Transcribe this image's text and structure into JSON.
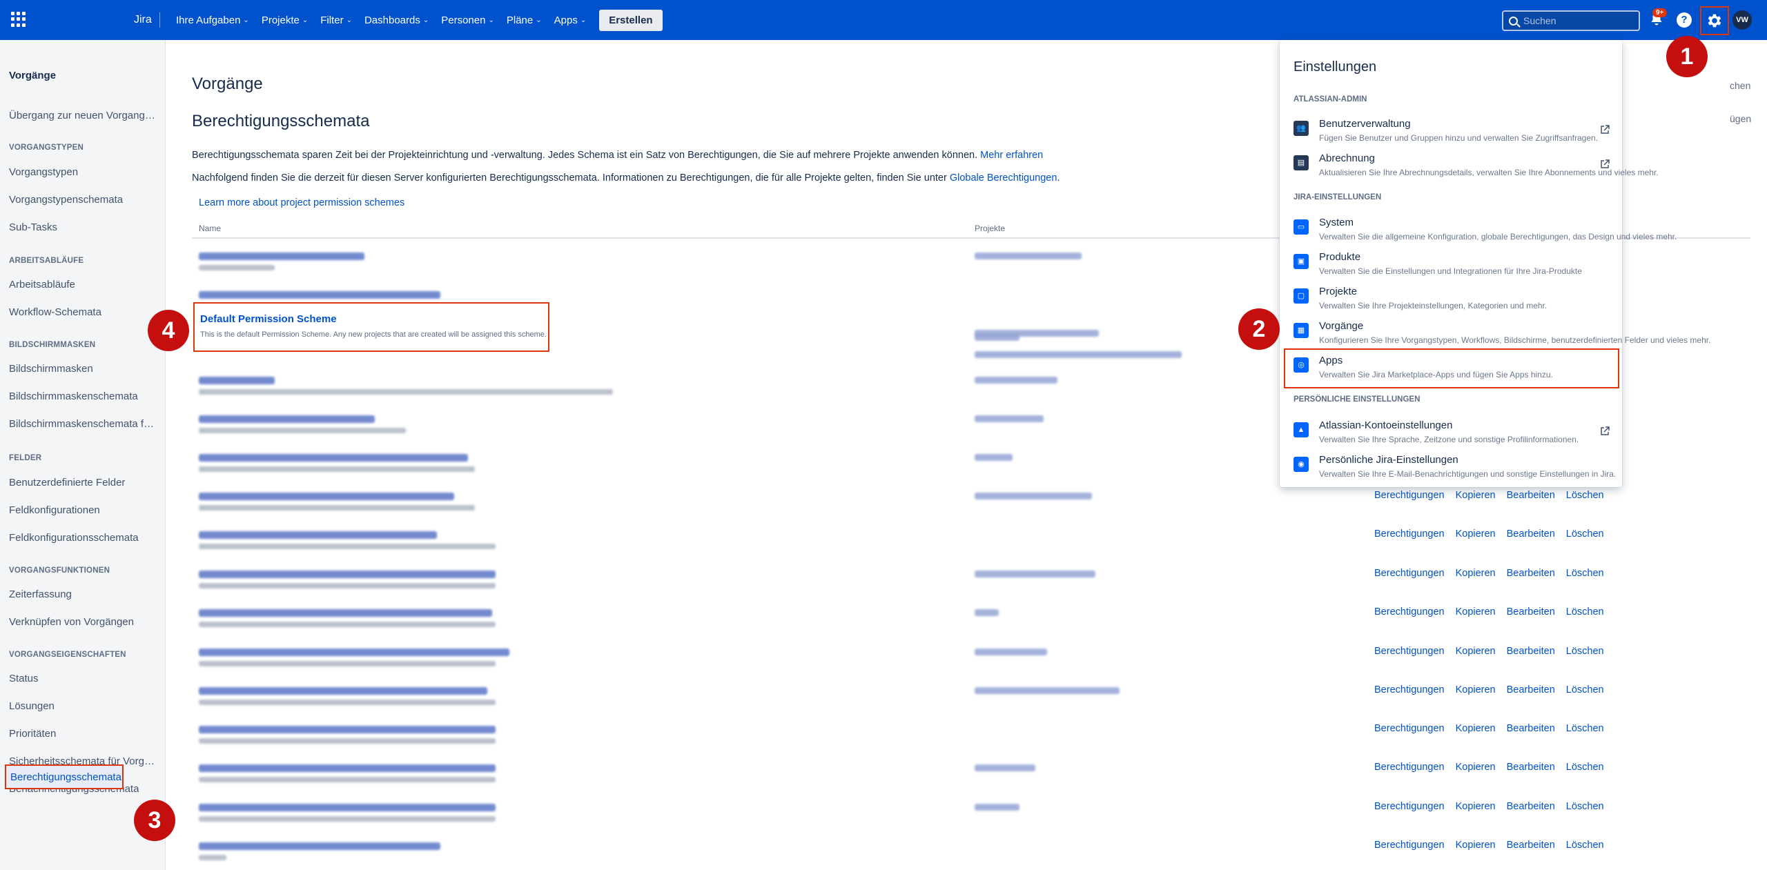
{
  "topbar": {
    "logo": "Jira",
    "nav": [
      "Ihre Aufgaben",
      "Projekte",
      "Filter",
      "Dashboards",
      "Personen",
      "Pläne",
      "Apps"
    ],
    "create_label": "Erstellen",
    "search_placeholder": "Suchen",
    "notifications_badge": "9+",
    "help_label": "?",
    "avatar_initials": "VW"
  },
  "sidebar": {
    "title": "Vorgänge",
    "items": [
      {
        "type": "item",
        "label": "Übergang zur neuen Vorgangs..."
      },
      {
        "type": "head",
        "label": "VORGANGSTYPEN"
      },
      {
        "type": "item",
        "label": "Vorgangstypen"
      },
      {
        "type": "item",
        "label": "Vorgangstypenschemata"
      },
      {
        "type": "item",
        "label": "Sub-Tasks"
      },
      {
        "type": "head",
        "label": "ARBEITSABLÄUFE"
      },
      {
        "type": "item",
        "label": "Arbeitsabläufe"
      },
      {
        "type": "item",
        "label": "Workflow-Schemata"
      },
      {
        "type": "head",
        "label": "BILDSCHIRMMASKEN"
      },
      {
        "type": "item",
        "label": "Bildschirmmasken"
      },
      {
        "type": "item",
        "label": "Bildschirmmaskenschemata"
      },
      {
        "type": "item",
        "label": "Bildschirmmaskenschemata für..."
      },
      {
        "type": "head",
        "label": "FELDER"
      },
      {
        "type": "item",
        "label": "Benutzerdefinierte Felder"
      },
      {
        "type": "item",
        "label": "Feldkonfigurationen"
      },
      {
        "type": "item",
        "label": "Feldkonfigurationsschemata"
      },
      {
        "type": "head",
        "label": "VORGANGSFUNKTIONEN"
      },
      {
        "type": "item",
        "label": "Zeiterfassung"
      },
      {
        "type": "item",
        "label": "Verknüpfen von Vorgängen"
      },
      {
        "type": "head",
        "label": "VORGANGSEIGENSCHAFTEN"
      },
      {
        "type": "item",
        "label": "Status"
      },
      {
        "type": "item",
        "label": "Lösungen"
      },
      {
        "type": "item",
        "label": "Prioritäten"
      },
      {
        "type": "item",
        "label": "Sicherheitsschemata für Vorgä..."
      },
      {
        "type": "item",
        "label": "Benachrichtigungsschemata"
      }
    ],
    "active": "Berechtigungsschemata"
  },
  "main": {
    "title": "Vorgänge",
    "subtitle": "Berechtigungsschemata",
    "desc1": "Berechtigungsschemata sparen Zeit bei der Projekteinrichtung und -verwaltung. Jedes Schema ist ein Satz von Berechtigungen, die Sie auf mehrere Projekte anwenden können.",
    "desc1_link": "Mehr erfahren",
    "desc2": "Nachfolgend finden Sie die derzeit für diesen Server konfigurierten Berechtigungsschemata. Informationen zu Berechtigungen, die für alle Projekte gelten, finden Sie unter",
    "desc2_link": "Globale Berechtigungen",
    "desc2_end": ".",
    "learn_more": "Learn more about project permission schemes",
    "col_name": "Name",
    "col_projects": "Projekte",
    "edge_top": "chen",
    "edge_btn": "ügen",
    "default_scheme": {
      "name": "Default Permission Scheme",
      "desc": "This is the default Permission Scheme. Any new projects that are created will be assigned this scheme."
    },
    "ops": {
      "permissions": "Berechtigungen",
      "copy": "Kopieren",
      "edit": "Bearbeiten",
      "delete": "Löschen"
    }
  },
  "markers": [
    "1",
    "2",
    "3",
    "4"
  ],
  "dropdown": {
    "title": "Einstellungen",
    "sections": [
      {
        "head": "ATLASSIAN-ADMIN",
        "items": [
          {
            "label": "Benutzerverwaltung",
            "sub": "Fügen Sie Benutzer und Gruppen hinzu und verwalten Sie Zugriffsanfragen.",
            "icon": "users-icon",
            "external": true
          },
          {
            "label": "Abrechnung",
            "sub": "Aktualisieren Sie Ihre Abrechnungsdetails, verwalten Sie Ihre Abonnements und vieles mehr.",
            "icon": "billing-icon",
            "external": true
          }
        ]
      },
      {
        "head": "JIRA-EINSTELLUNGEN",
        "items": [
          {
            "label": "System",
            "sub": "Verwalten Sie die allgemeine Konfiguration, globale Berechtigungen, das Design und vieles mehr.",
            "icon": "monitor-icon",
            "external": false
          },
          {
            "label": "Produkte",
            "sub": "Verwalten Sie die Einstellungen und Integrationen für Ihre Jira-Produkte",
            "icon": "products-icon",
            "external": false
          },
          {
            "label": "Projekte",
            "sub": "Verwalten Sie Ihre Projekteinstellungen, Kategorien und mehr.",
            "icon": "folder-icon",
            "external": false
          },
          {
            "label": "Vorgänge",
            "sub": "Konfigurieren Sie Ihre Vorgangstypen, Workflows, Bildschirme, benutzerdefinierten Felder und vieles mehr.",
            "icon": "issues-icon",
            "external": false
          },
          {
            "label": "Apps",
            "sub": "Verwalten Sie Jira Marketplace-Apps und fügen Sie Apps hinzu.",
            "icon": "apps-icon",
            "external": false
          }
        ]
      },
      {
        "head": "PERSÖNLICHE EINSTELLUNGEN",
        "items": [
          {
            "label": "Atlassian-Kontoeinstellungen",
            "sub": "Verwalten Sie Ihre Sprache, Zeitzone und sonstige Profilinformationen.",
            "icon": "atlassian-icon",
            "external": true
          },
          {
            "label": "Persönliche Jira-Einstellungen",
            "sub": "Verwalten Sie Ihre E-Mail-Benachrichtigungen und sonstige Einstellungen in Jira.",
            "icon": "person-icon",
            "external": false
          }
        ]
      }
    ]
  },
  "colors": {
    "brand": "#0052cc",
    "highlight": "#de350b",
    "marker": "#c50f0f",
    "link": "#0052cc"
  }
}
